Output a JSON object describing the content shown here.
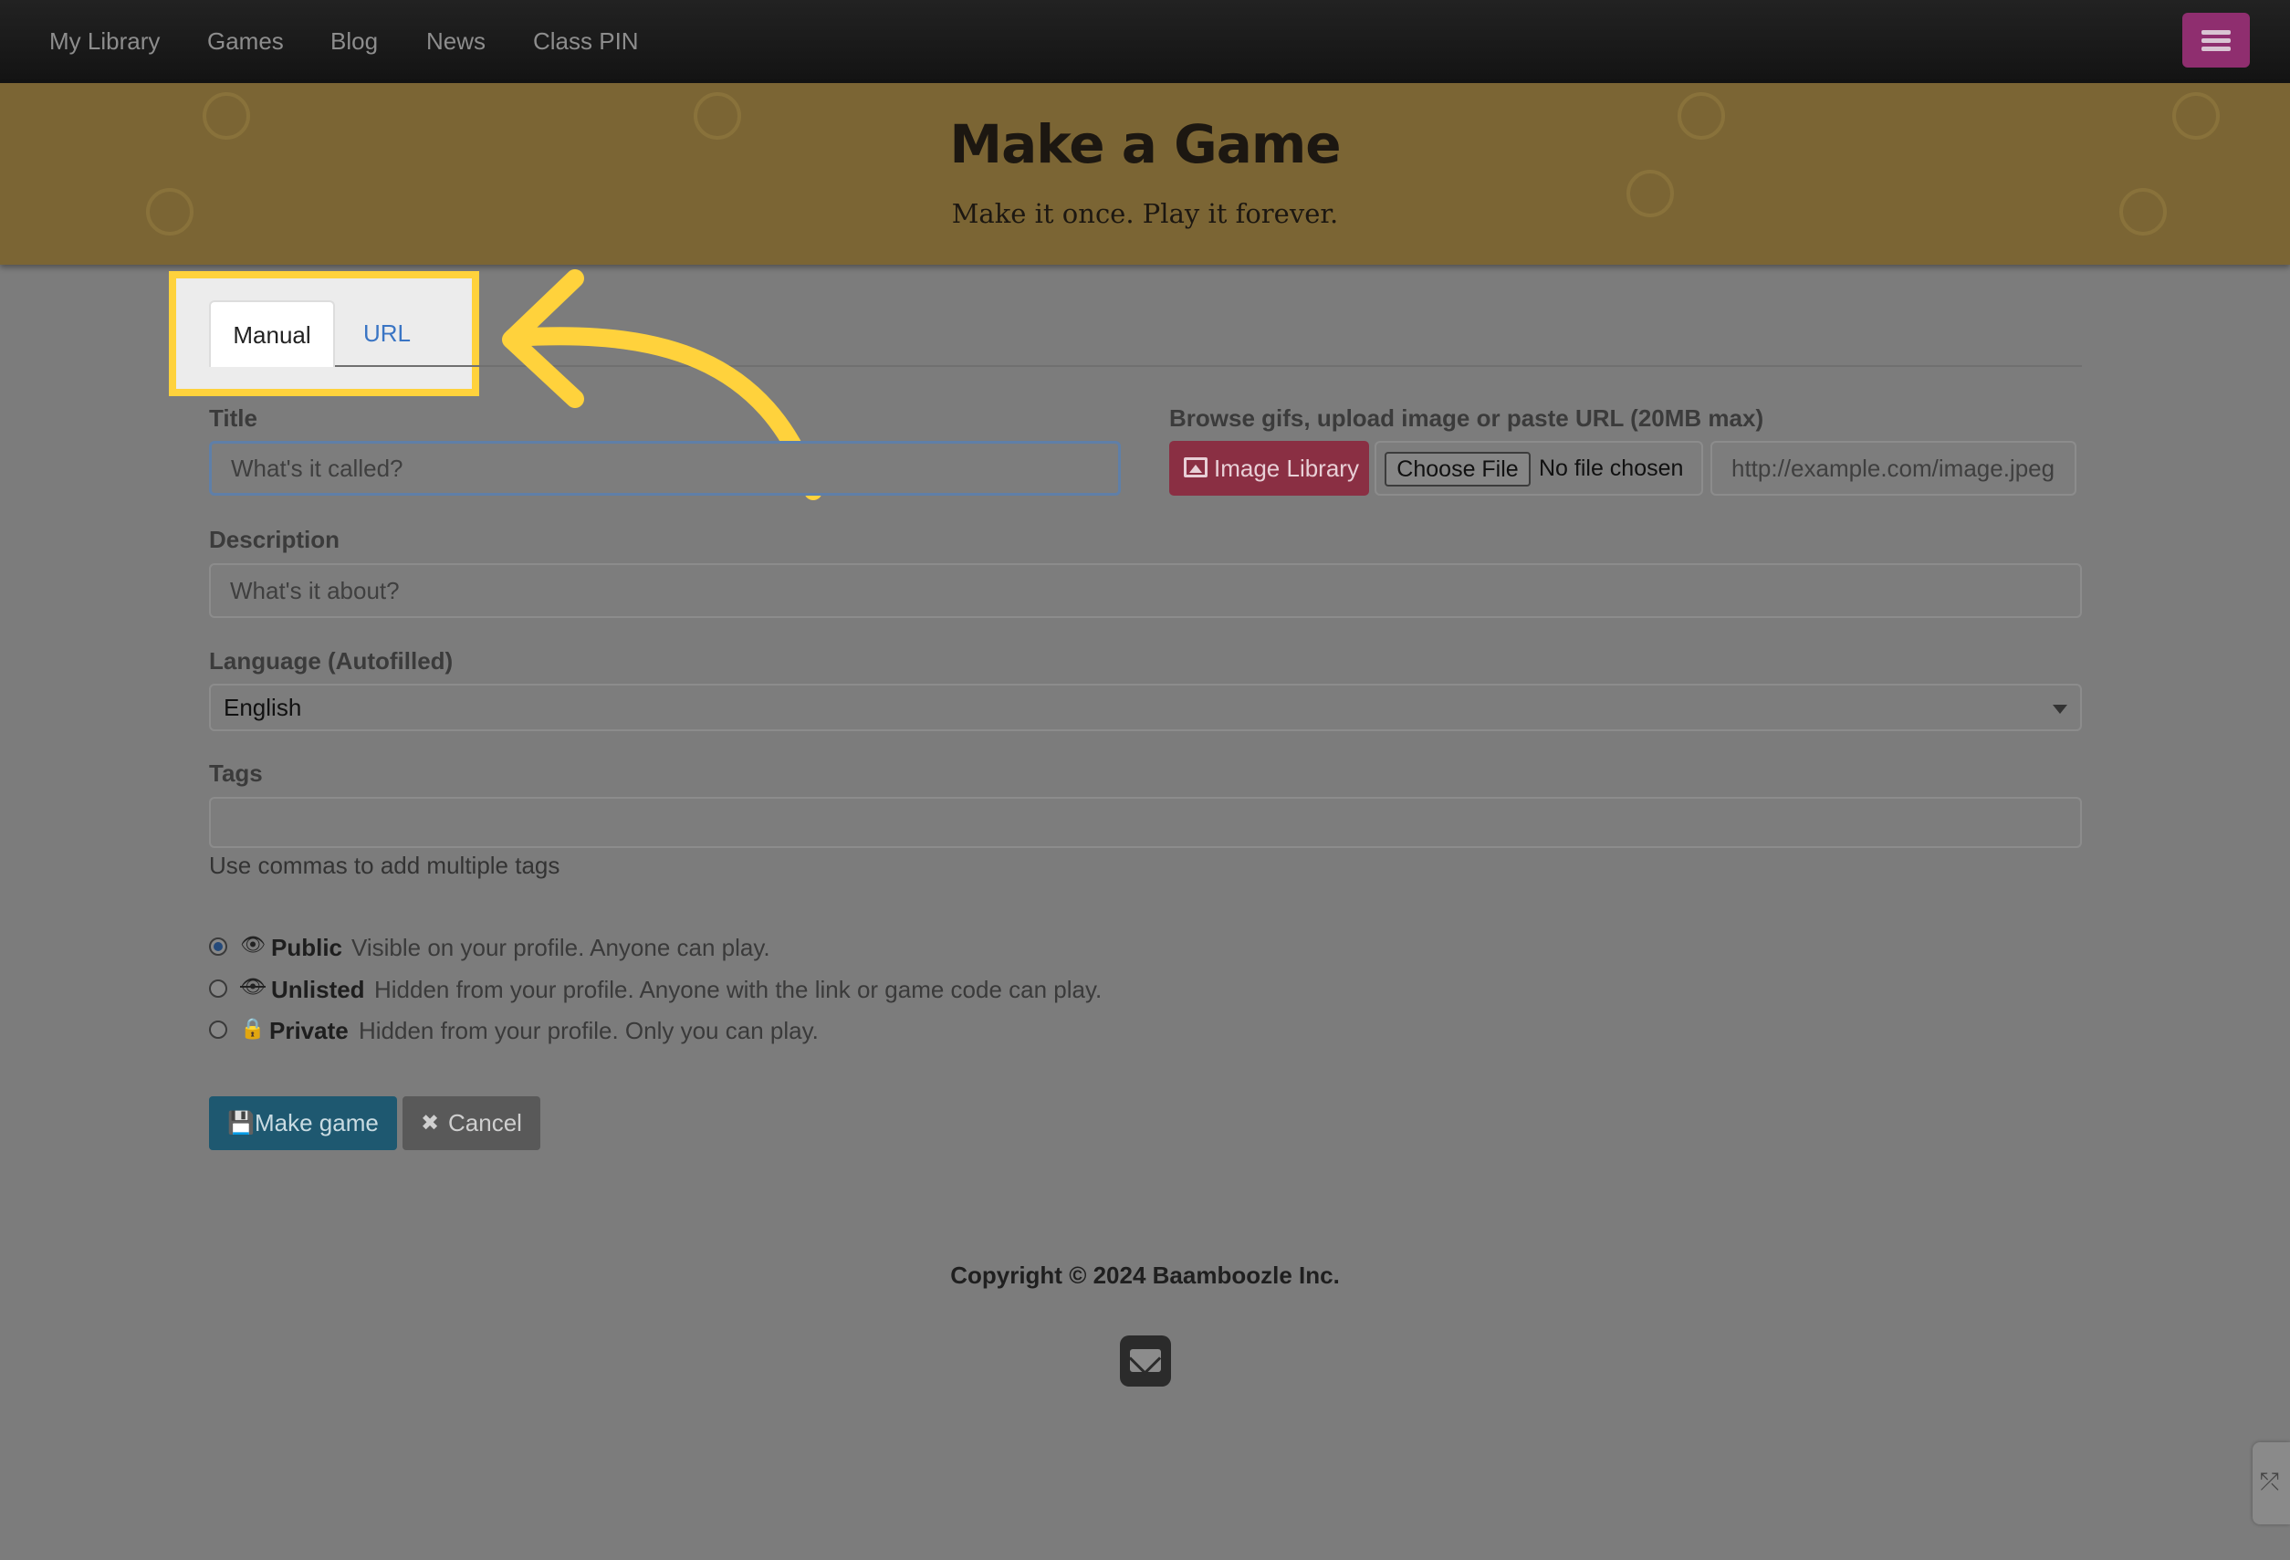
{
  "navbar": {
    "items": [
      "My Library",
      "Games",
      "Blog",
      "News",
      "Class PIN"
    ]
  },
  "banner": {
    "title": "Make a Game",
    "subtitle": "Make it once. Play it forever."
  },
  "tabs": {
    "manual": "Manual",
    "url": "URL"
  },
  "form": {
    "title_label": "Title",
    "title_placeholder": "What's it called?",
    "image_label": "Browse gifs, upload image or paste URL (20MB max)",
    "image_library_button": "Image Library",
    "choose_file_button": "Choose File",
    "no_file_text": "No file chosen",
    "image_url_placeholder": "http://example.com/image.jpeg",
    "description_label": "Description",
    "description_placeholder": "What's it about?",
    "language_label": "Language (Autofilled)",
    "language_value": "English",
    "tags_label": "Tags",
    "tags_value": "",
    "tags_help": "Use commas to add multiple tags"
  },
  "visibility": [
    {
      "label": "Public",
      "desc": "Visible on your profile. Anyone can play.",
      "checked": true,
      "icon": "eye-icon"
    },
    {
      "label": "Unlisted",
      "desc": "Hidden from your profile. Anyone with the link or game code can play.",
      "checked": false,
      "icon": "eye-slash-icon"
    },
    {
      "label": "Private",
      "desc": "Hidden from your profile. Only you can play.",
      "checked": false,
      "icon": "lock-icon"
    }
  ],
  "buttons": {
    "make_game": "Make game",
    "cancel": "Cancel"
  },
  "footer": {
    "copyright": "Copyright © 2024 Baamboozle Inc."
  },
  "colors": {
    "highlight": "#ffd23c",
    "image_library": "#8a2f43",
    "make_game": "#1e5870",
    "menu_button": "#8f2e6f"
  }
}
